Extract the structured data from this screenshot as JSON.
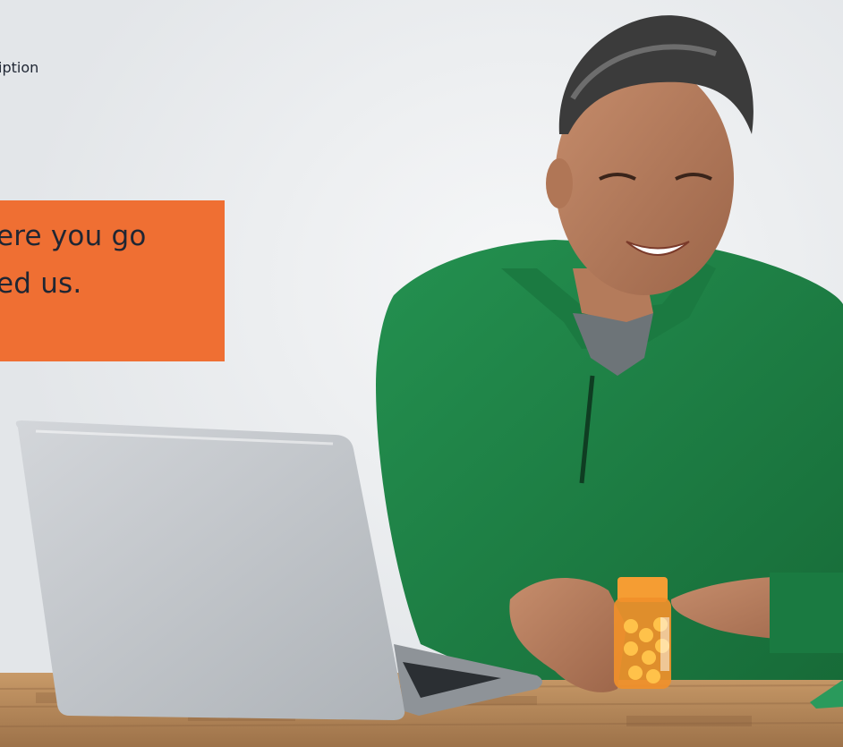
{
  "hero": {
    "eyebrow": "iption",
    "headline_line1": "ere you go",
    "headline_line2": "ed us."
  },
  "colors": {
    "background": "#e9ebed",
    "promo_box": "#ef6f33",
    "text": "#1f2633",
    "sweater": "#1f8446",
    "laptop": "#c3c7cc",
    "pill_bottle": "#f0902a",
    "table_wood": "#b88a5c"
  }
}
